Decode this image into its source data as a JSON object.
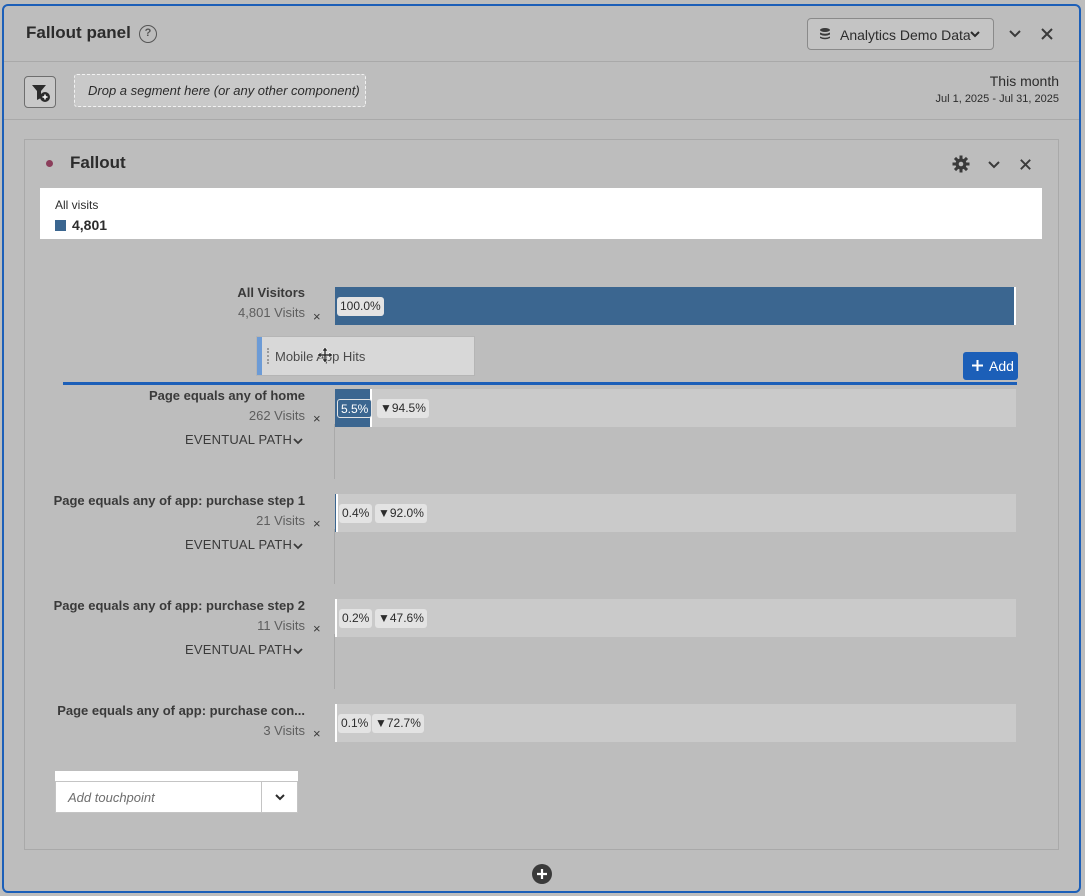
{
  "panel": {
    "title": "Fallout panel",
    "help_glyph": "?",
    "data_source": "Analytics Demo Data"
  },
  "segment_bar": {
    "drop_placeholder": "Drop a segment here (or any other component)",
    "date_label": "This month",
    "date_range": "Jul 1, 2025 - Jul 31, 2025"
  },
  "viz": {
    "title": "Fallout",
    "legend": {
      "name": "All visits",
      "value": "4,801",
      "color": "#3b6690"
    },
    "steps": [
      {
        "name": "All Visitors",
        "visits": "4,801 Visits",
        "remove": "×",
        "percent_label": "100.0%",
        "fill_percent": 100.0
      },
      {
        "name": "Page equals any of home",
        "visits": "262 Visits",
        "remove": "×",
        "percent_label": "5.5%",
        "dropoff_label": "▼94.5%",
        "path_label": "EVENTUAL PATH",
        "fill_percent": 5.5
      },
      {
        "name": "Page equals any of app: purchase step 1",
        "visits": "21 Visits",
        "remove": "×",
        "percent_label": "0.4%",
        "dropoff_label": "▼92.0%",
        "path_label": "EVENTUAL PATH",
        "fill_percent": 0.4
      },
      {
        "name": "Page equals any of app: purchase step 2",
        "visits": "11 Visits",
        "remove": "×",
        "percent_label": "0.2%",
        "dropoff_label": "▼47.6%",
        "path_label": "EVENTUAL PATH",
        "fill_percent": 0.2
      },
      {
        "name": "Page equals any of app: purchase con...",
        "visits": "3 Visits",
        "remove": "×",
        "percent_label": "0.1%",
        "dropoff_label": "▼72.7%",
        "fill_percent": 0.1
      }
    ],
    "dragging_chip": "Mobile App Hits",
    "add_button": "Add",
    "touchpoint_placeholder": "Add touchpoint"
  },
  "colors": {
    "accent": "#1c5fb8",
    "bar": "#3b6690",
    "dot": "#8b3e5b"
  }
}
